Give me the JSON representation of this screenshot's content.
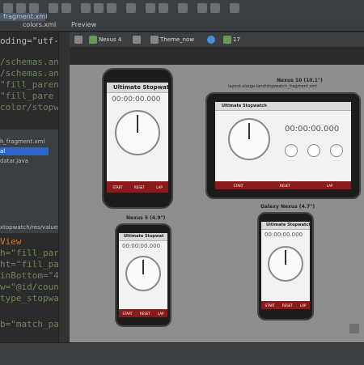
{
  "window": {
    "top_tab": "fragment.xml",
    "editor_tabs": [
      "colors.xml",
      "Preview"
    ]
  },
  "editor_top": {
    "lines": [
      {
        "text": "oding=\"utf-",
        "kind": "attr"
      },
      {
        "text": "",
        "kind": "blank"
      },
      {
        "text": "/schemas.an",
        "kind": "str"
      },
      {
        "text": "/schemas.and",
        "kind": "str"
      },
      {
        "text": "\"fill_paren",
        "kind": "str"
      },
      {
        "text": "\"fill_pare",
        "kind": "str"
      },
      {
        "text": "color/stopw",
        "kind": "str"
      }
    ]
  },
  "project_tree": {
    "items": [
      "h_fragment.xml",
      "al",
      "datar.java",
      "",
      "",
      "",
      "",
      "",
      "",
      "",
      "xtopwatch/res/values"
    ],
    "selected_index": 1
  },
  "editor_bottom": {
    "lines": [
      {
        "text": "View",
        "kind": "kw"
      },
      {
        "text": "h=\"fill_paren",
        "kind": "str"
      },
      {
        "text": "ht=\"fill_par",
        "kind": "str"
      },
      {
        "text": "inBottom=\"4",
        "kind": "str"
      },
      {
        "text": "w=\"@id/coun",
        "kind": "str"
      },
      {
        "text": "type_stopwat",
        "kind": "str"
      },
      {
        "text": "",
        "kind": "blank"
      },
      {
        "text": "b=\"match_pa",
        "kind": "str"
      }
    ]
  },
  "preview_toolbar": {
    "device": "Nexus 4",
    "theme": "Theme_now",
    "api": "17"
  },
  "preview": {
    "app_title": "Ultimate Stopwatch",
    "app_title_short": "Ultimate Stopwat",
    "timer": "00:00:00.000",
    "buttons": [
      "START",
      "RESET",
      "LAP"
    ],
    "devices": [
      {
        "label": "Nexus 10 (10.1\")",
        "sublabel": "layout-xlarge-land/stopwatch_fragment.xml"
      },
      {
        "label": "Nexus 5 (4.9\")"
      },
      {
        "label": "Galaxy Nexus (4.7\")"
      }
    ]
  },
  "colors": {
    "ide_bg": "#2b2b2b",
    "panel": "#3c3f41",
    "canvas": "#8e8e8e",
    "button_bar": "#8b1a1a",
    "string": "#6a8759",
    "keyword": "#cc7832",
    "selection": "#2f65ca"
  }
}
